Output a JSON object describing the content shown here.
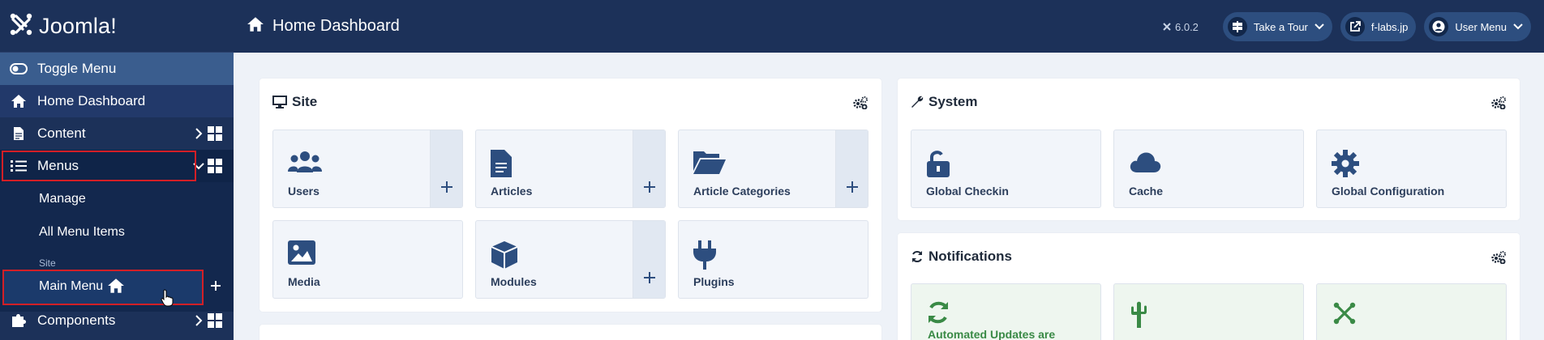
{
  "app": {
    "logo_text": "Joomla!",
    "brand_color": "#1c3159"
  },
  "sidebar": {
    "toggle_label": "Toggle Menu",
    "home_label": "Home Dashboard",
    "content_label": "Content",
    "menus_label": "Menus",
    "menus_sub": {
      "manage": "Manage",
      "all_items": "All Menu Items",
      "site_heading": "Site",
      "main_menu": "Main Menu"
    },
    "components_label": "Components"
  },
  "header": {
    "title": "Home Dashboard",
    "version": "6.0.2",
    "take_tour": "Take a Tour",
    "site_link": "f-labs.jp",
    "user_menu": "User Menu"
  },
  "site_card": {
    "title": "Site",
    "tiles": [
      {
        "label": "Users",
        "icon": "users-icon",
        "has_add": true
      },
      {
        "label": "Articles",
        "icon": "file-alt-icon",
        "has_add": true
      },
      {
        "label": "Article Categories",
        "icon": "folder-open-icon",
        "has_add": true
      },
      {
        "label": "Media",
        "icon": "image-icon",
        "has_add": false
      },
      {
        "label": "Modules",
        "icon": "cube-icon",
        "has_add": true
      },
      {
        "label": "Plugins",
        "icon": "plug-icon",
        "has_add": false
      }
    ]
  },
  "system_card": {
    "title": "System",
    "tiles": [
      {
        "label": "Global Checkin",
        "icon": "unlock-icon"
      },
      {
        "label": "Cache",
        "icon": "cloud-icon"
      },
      {
        "label": "Global Configuration",
        "icon": "cog-icon"
      }
    ]
  },
  "notifications_card": {
    "title": "Notifications",
    "tiles": [
      {
        "label": "Automated Updates are",
        "icon": "sync-icon"
      },
      {
        "label": "",
        "icon": "cactus-icon"
      },
      {
        "label": "",
        "icon": "joomla-icon"
      }
    ]
  },
  "colors": {
    "accent": "#3a5d8e",
    "tile_icon": "#2d4e7f",
    "notice_green": "#3a8a46",
    "highlight_red": "#d31f26"
  }
}
